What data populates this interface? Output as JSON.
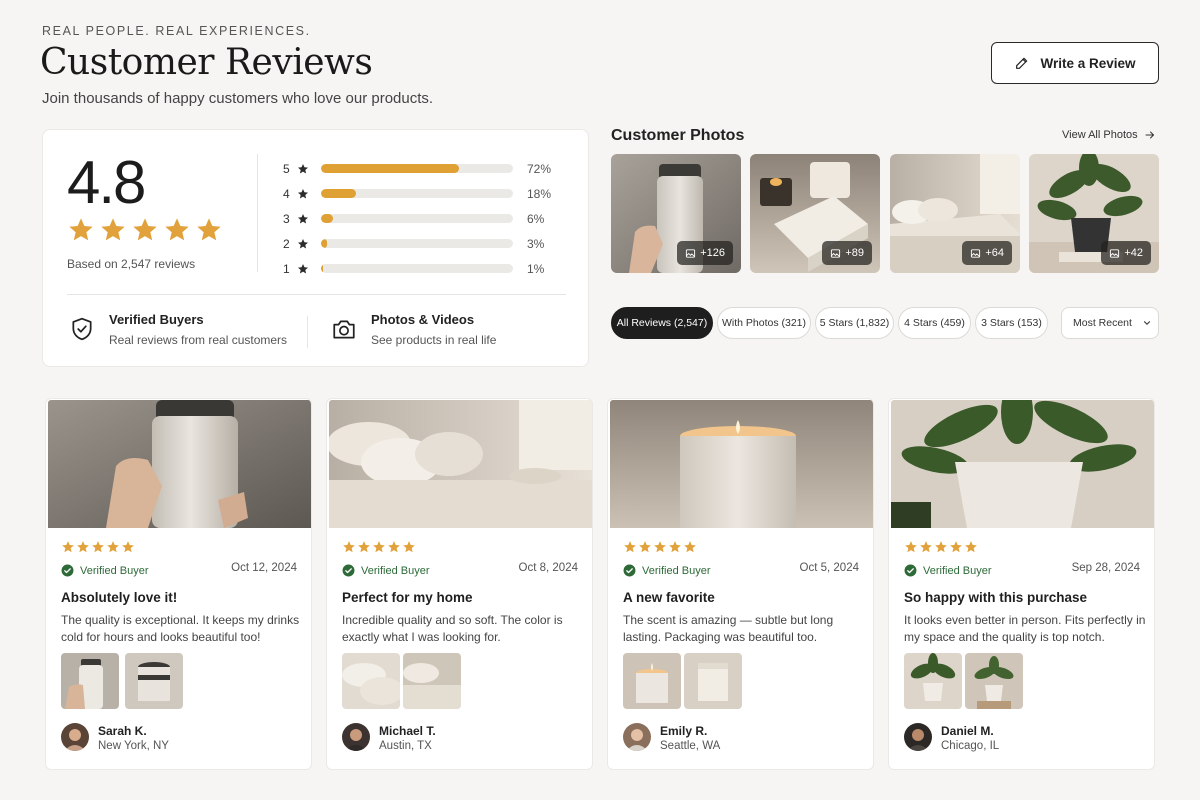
{
  "header": {
    "eyebrow": "REAL PEOPLE. REAL EXPERIENCES.",
    "title": "Customer Reviews",
    "subtitle": "Join thousands of happy customers who love our products.",
    "write_review_label": "Write a Review"
  },
  "summary": {
    "average": "4.8",
    "average_stars": 5,
    "based_on": "Based on 2,547 reviews",
    "distribution": [
      {
        "stars": "5",
        "percent_label": "72%",
        "fraction": 0.72
      },
      {
        "stars": "4",
        "percent_label": "18%",
        "fraction": 0.18
      },
      {
        "stars": "3",
        "percent_label": "6%",
        "fraction": 0.06
      },
      {
        "stars": "2",
        "percent_label": "3%",
        "fraction": 0.03
      },
      {
        "stars": "1",
        "percent_label": "1%",
        "fraction": 0.01
      }
    ],
    "features": [
      {
        "icon": "shield-check-icon",
        "title": "Verified Buyers",
        "subtitle": "Real reviews from real customers"
      },
      {
        "icon": "camera-icon",
        "title": "Photos & Videos",
        "subtitle": "See products in real life"
      }
    ]
  },
  "customer_photos": {
    "title": "Customer Photos",
    "view_all": "View All Photos",
    "items": [
      {
        "subject": "tumbler",
        "count": "+126"
      },
      {
        "subject": "candle-box",
        "count": "+89"
      },
      {
        "subject": "bedroom",
        "count": "+64"
      },
      {
        "subject": "plant",
        "count": "+42"
      }
    ]
  },
  "filters": {
    "chips": [
      {
        "label": "All Reviews (2,547)",
        "active": true
      },
      {
        "label": "With Photos (321)",
        "active": false
      },
      {
        "label": "5 Stars (1,832)",
        "active": false
      },
      {
        "label": "4 Stars (459)",
        "active": false
      },
      {
        "label": "3 Stars (153)",
        "active": false
      }
    ],
    "sort_label": "Most Recent"
  },
  "reviews": [
    {
      "rating": 5,
      "verified": "Verified Buyer",
      "date": "Oct 12, 2024",
      "title": "Absolutely love it!",
      "body": "The quality is exceptional. It keeps my drinks cold for hours and looks beautiful too!",
      "name": "Sarah K.",
      "location": "New York, NY",
      "subject": "tumbler"
    },
    {
      "rating": 5,
      "verified": "Verified Buyer",
      "date": "Oct 8, 2024",
      "title": "Perfect for my home",
      "body": "Incredible quality and so soft. The color is exactly what I was looking for.",
      "name": "Michael T.",
      "location": "Austin, TX",
      "subject": "bedding"
    },
    {
      "rating": 5,
      "verified": "Verified Buyer",
      "date": "Oct 5, 2024",
      "title": "A new favorite",
      "body": "The scent is amazing — subtle but long lasting. Packaging was beautiful too.",
      "name": "Emily R.",
      "location": "Seattle, WA",
      "subject": "candle"
    },
    {
      "rating": 5,
      "verified": "Verified Buyer",
      "date": "Sep 28, 2024",
      "title": "So happy with this purchase",
      "body": "It looks even better in person. Fits perfectly in my space and the quality is top notch.",
      "name": "Daniel M.",
      "location": "Chicago, IL",
      "subject": "plant"
    }
  ],
  "colors": {
    "star": "#e2a23b",
    "bar_fill": "#dfa133",
    "verified": "#2d6a38",
    "active_chip": "#1e1e1e"
  }
}
